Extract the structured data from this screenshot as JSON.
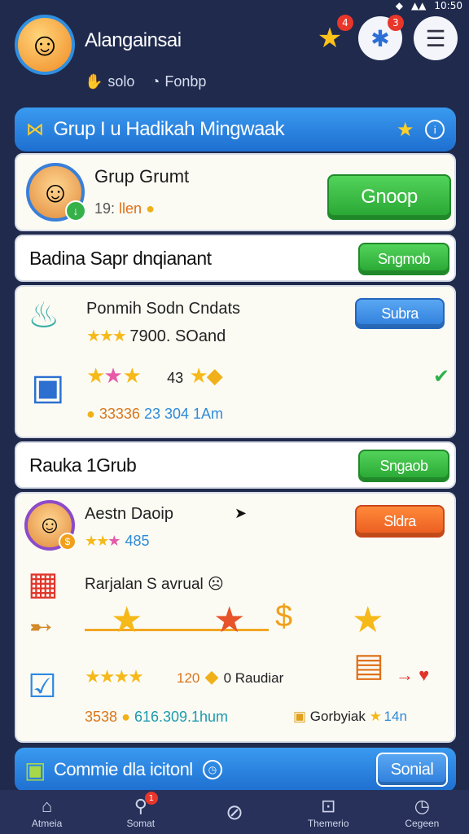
{
  "status": {
    "signal": "▲▲",
    "time": "10:50"
  },
  "header": {
    "profile_name": "Alangainsai",
    "meta_1": "solo",
    "meta_2": "Fonbp",
    "star_badge": "4",
    "puzzle_badge": "3"
  },
  "banner": {
    "title": "Grup I u Hadikah Mingwaak"
  },
  "group_card": {
    "title": "Grup Grumt",
    "sub_prefix": "19:",
    "sub_highlight": "llen",
    "button": "Gnoop"
  },
  "section_1": {
    "label": "Badina Sapr dnqianant",
    "button": "Sngmob"
  },
  "reward_card": {
    "row1_title": "Ponmih Sodn Cndats",
    "row1_value": "7900. SOand",
    "row1_button": "Subra",
    "row2_count": "43",
    "row2_coins": "33336",
    "row2_time": "23 304 1Am"
  },
  "section_2": {
    "label": "Rauka 1Grub",
    "button": "Sngaob"
  },
  "player_card": {
    "player_name": "Aestn Daoip",
    "player_score": "485",
    "player_button": "Sldra",
    "event_title": "Rarjalan S avrual",
    "val_a": "120",
    "val_b": "0 Raudiar",
    "coins": "3538",
    "time": "616.309.1hum",
    "gift_label": "Gorbyiak",
    "gift_value": "14n"
  },
  "bottom_bar": {
    "label": "Commie dla icitonl",
    "button": "Sonial"
  },
  "nav": [
    {
      "label": "Atmeia",
      "icon": "home-icon"
    },
    {
      "label": "Somat",
      "icon": "search-icon",
      "badge": "1"
    },
    {
      "label": "",
      "icon": "compass-icon"
    },
    {
      "label": "Themerio",
      "icon": "shop-icon"
    },
    {
      "label": "Cegeen",
      "icon": "clock-icon"
    }
  ],
  "colors": {
    "primary": "#2d7ddb",
    "success": "#27a532",
    "accent": "#ea5a1e",
    "background": "#1f2a4d"
  }
}
